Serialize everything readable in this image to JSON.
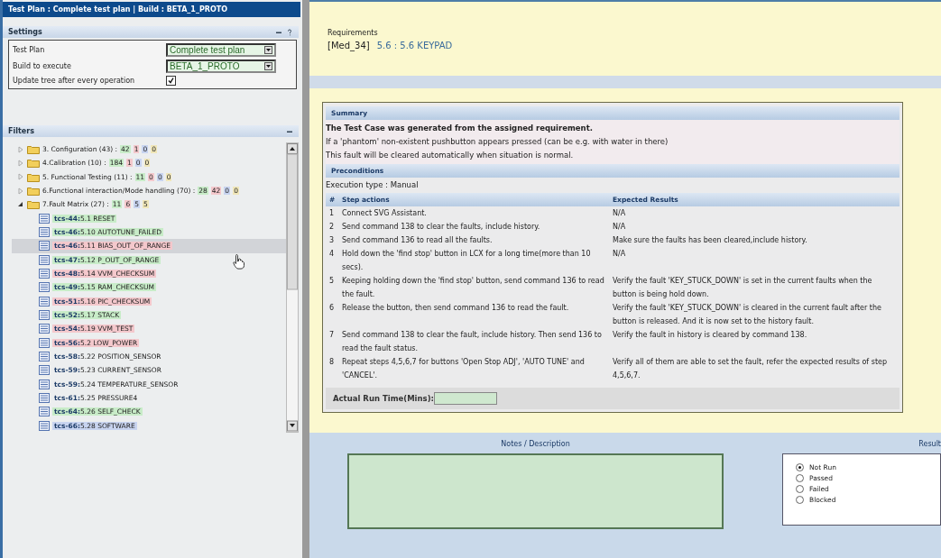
{
  "window": {
    "title": "Test Plan : Complete test plan | Build : BETA_1_PROTO"
  },
  "settings": {
    "title": "Settings",
    "fields": [
      {
        "kind": "select",
        "label": "Test Plan",
        "value": "Complete test plan"
      },
      {
        "kind": "select",
        "label": "Build to execute",
        "value": "BETA_1_PROTO"
      },
      {
        "kind": "checkbox",
        "label": "Update tree after every operation",
        "checked": true
      }
    ]
  },
  "filters": {
    "title": "Filters",
    "tree": [
      {
        "kind": "folder",
        "label": "3. Configuration (43) :",
        "expanded": false,
        "counts": [
          {
            "text": "42",
            "color": "#c8ecc8"
          },
          {
            "text": "1",
            "color": "#f4c8cc"
          },
          {
            "text": "0",
            "color": "#c8d4f0"
          },
          {
            "text": "0",
            "color": "#f0e6b8"
          }
        ]
      },
      {
        "kind": "folder",
        "label": "4.Calibration (10) :",
        "expanded": false,
        "counts": [
          {
            "text": "184",
            "color": "#c8ecc8"
          },
          {
            "text": "1",
            "color": "#f4c8cc"
          },
          {
            "text": "0",
            "color": "#c8d4f0"
          },
          {
            "text": "0",
            "color": "#f0e6b8"
          }
        ]
      },
      {
        "kind": "folder",
        "label": "5. Functional Testing (11) :",
        "expanded": false,
        "counts": [
          {
            "text": "11",
            "color": "#c8ecc8"
          },
          {
            "text": "0",
            "color": "#f4c8cc"
          },
          {
            "text": "0",
            "color": "#c8d4f0"
          },
          {
            "text": "0",
            "color": "#f0e6b8"
          }
        ]
      },
      {
        "kind": "folder",
        "label": "6.Functional interaction/Mode handling (70) :",
        "expanded": false,
        "counts": [
          {
            "text": "28",
            "color": "#c8ecc8"
          },
          {
            "text": "42",
            "color": "#f4c8cc"
          },
          {
            "text": "0",
            "color": "#c8d4f0"
          },
          {
            "text": "0",
            "color": "#f0e6b8"
          }
        ]
      },
      {
        "kind": "folder",
        "label": "7.Fault Matrix (27) :",
        "expanded": true,
        "counts": [
          {
            "text": "11",
            "color": "#c8ecc8"
          },
          {
            "text": "6",
            "color": "#f4c8cc"
          },
          {
            "text": "5",
            "color": "#c8d4f0"
          },
          {
            "text": "5",
            "color": "#f0e6b8"
          }
        ],
        "children": [
          {
            "kind": "testcase",
            "id": "tcs-44:",
            "label": "5.1 RESET",
            "color": "#c8ecc8",
            "selected": false
          },
          {
            "kind": "testcase",
            "id": "tcs-46:",
            "label": "5.10 AUTOTUNE_FAILED",
            "color": "#c8ecc8",
            "selected": false
          },
          {
            "kind": "testcase",
            "id": "tcs-46:",
            "label": "5.11 BIAS_OUT_OF_RANGE",
            "color": "#f4c8cc",
            "selected": true
          },
          {
            "kind": "testcase",
            "id": "tcs-47:",
            "label": "5.12 P_OUT_OF_RANGE",
            "color": "#c8ecc8",
            "selected": false
          },
          {
            "kind": "testcase",
            "id": "tcs-48:",
            "label": "5.14 VVM_CHECKSUM",
            "color": "#f4c8cc",
            "selected": false
          },
          {
            "kind": "testcase",
            "id": "tcs-49:",
            "label": "5.15 RAM_CHECKSUM",
            "color": "#c8ecc8",
            "selected": false
          },
          {
            "kind": "testcase",
            "id": "tcs-51:",
            "label": "5.16 PIC_CHECKSUM",
            "color": "#f4c8cc",
            "selected": false
          },
          {
            "kind": "testcase",
            "id": "tcs-52:",
            "label": "5.17 STACK",
            "color": "#c8ecc8",
            "selected": false
          },
          {
            "kind": "testcase",
            "id": "tcs-54:",
            "label": "5.19 VVM_TEST",
            "color": "#f4c8cc",
            "selected": false
          },
          {
            "kind": "testcase",
            "id": "tcs-56:",
            "label": "5.2 LOW_POWER",
            "color": "#f4c8cc",
            "selected": false
          },
          {
            "kind": "testcase",
            "id": "tcs-58:",
            "label": "5.22 POSITION_SENSOR",
            "selected": false
          },
          {
            "kind": "testcase",
            "id": "tcs-59:",
            "label": "5.23 CURRENT_SENSOR",
            "selected": false
          },
          {
            "kind": "testcase",
            "id": "tcs-59:",
            "label": "5.24 TEMPERATURE_SENSOR",
            "selected": false
          },
          {
            "kind": "testcase",
            "id": "tcs-61:",
            "label": "5.25 PRESSURE4",
            "selected": false
          },
          {
            "kind": "testcase",
            "id": "tcs-64:",
            "label": "5.26 SELF_CHECK",
            "color": "#c8ecc8",
            "selected": false
          },
          {
            "kind": "testcase",
            "id": "tcs-66:",
            "label": "5.28 SOFTWARE",
            "color": "#c8d4f0",
            "selected": false
          }
        ]
      }
    ]
  },
  "requirements": {
    "label": "Requirements",
    "id": "[Med_34]",
    "text": "5.6 : 5.6 KEYPAD"
  },
  "summary": {
    "title": "Summary",
    "lines": [
      "The Test Case was generated from the assigned requirement.",
      "If a 'phantom' non-existent pushbutton appears pressed (can be e.g. with water in there)",
      "This fault will be cleared automatically when situation is normal."
    ]
  },
  "preconditions": {
    "title": "Preconditions",
    "execution_type": "Execution type : Manual"
  },
  "steps": {
    "columns": [
      "#",
      "Step actions",
      "Expected Results"
    ],
    "rows": [
      {
        "n": "1",
        "action": "Connect SVG Assistant.",
        "expected": "N/A"
      },
      {
        "n": "2",
        "action": "Send command 138 to clear the faults, include history.",
        "expected": "N/A"
      },
      {
        "n": "3",
        "action": "Send command 136 to read all the faults.",
        "expected": "Make sure the faults has been cleared,include history."
      },
      {
        "n": "4",
        "action": "Hold down the 'find stop' button in LCX for a long time(more than 10 secs).",
        "expected": "N/A"
      },
      {
        "n": "5",
        "action": "Keeping holding down the 'find stop' button, send command 136 to read the fault.",
        "expected": "Verify the fault 'KEY_STUCK_DOWN' is set in the current faults when the button is being hold down."
      },
      {
        "n": "6",
        "action": "Release the button, then send command 136 to read the fault.",
        "expected": "Verify the fault 'KEY_STUCK_DOWN' is cleared in the current fault after the button is released. And it is now set to the history fault."
      },
      {
        "n": "7",
        "action": "Send command 138 to clear the fault, include history. Then send 136 to read the fault status.",
        "expected": "Verify the fault in history is cleared by command 138."
      },
      {
        "n": "8",
        "action": "Repeat steps 4,5,6,7 for buttons 'Open Stop ADJ', 'AUTO TUNE' and 'CANCEL'.",
        "expected": "Verify all of them are able to set the fault, refer the expected results of step 4,5,6,7."
      }
    ]
  },
  "run_time": {
    "label": "Actual Run Time(Mins):"
  },
  "notes": {
    "label": "Notes / Description"
  },
  "result": {
    "label": "Result",
    "options": [
      {
        "label": "Not Run",
        "selected": true
      },
      {
        "label": "Passed",
        "selected": false
      },
      {
        "label": "Failed",
        "selected": false
      },
      {
        "label": "Blocked",
        "selected": false
      }
    ]
  }
}
